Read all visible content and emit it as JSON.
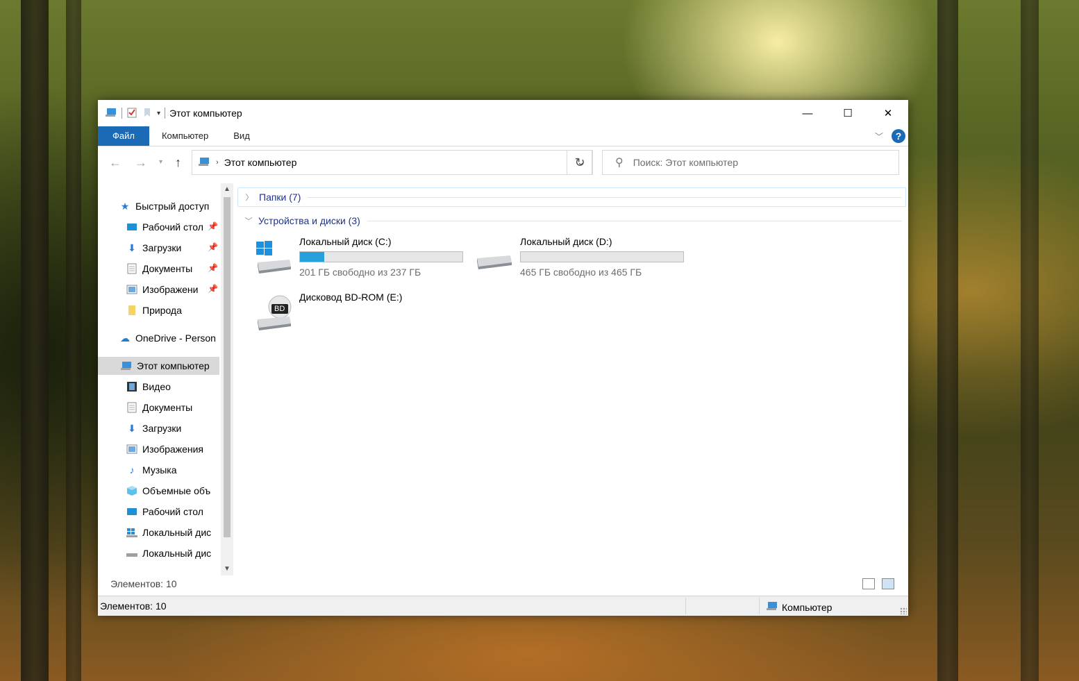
{
  "window": {
    "title": "Этот компьютер"
  },
  "window_controls": {
    "minimize": "—",
    "maximize": "☐",
    "close": "✕"
  },
  "ribbon": {
    "tabs": [
      "Файл",
      "Компьютер",
      "Вид"
    ],
    "help": "?"
  },
  "address_bar": {
    "path": "Этот компьютер"
  },
  "search": {
    "placeholder": "Поиск: Этот компьютер"
  },
  "nav_pane": {
    "quick_access": "Быстрый доступ",
    "quick_items": [
      "Рабочий стол",
      "Загрузки",
      "Документы",
      "Изображени",
      "Природа"
    ],
    "onedrive": "OneDrive - Person",
    "this_pc": "Этот компьютер",
    "pc_items": [
      "Видео",
      "Документы",
      "Загрузки",
      "Изображения",
      "Музыка",
      "Объемные объ",
      "Рабочий стол",
      "Локальный дис",
      "Локальный дис"
    ]
  },
  "content": {
    "folders_group": "Папки (7)",
    "devices_group": "Устройства и диски (3)",
    "drives": [
      {
        "name": "Локальный диск (C:)",
        "free": "201 ГБ свободно из 237 ГБ",
        "used_fraction": 0.15
      },
      {
        "name": "Локальный диск (D:)",
        "free": "465 ГБ свободно из 465 ГБ",
        "used_fraction": 0.0
      },
      {
        "name": "Дисковод BD-ROM (E:)",
        "badge": "BD"
      }
    ]
  },
  "status": {
    "inner_count": "Элементов: 10",
    "count": "Элементов: 10",
    "location": "Компьютер"
  },
  "colors": {
    "accent": "#1a6ab5",
    "progress": "#26a0da",
    "group_text": "#1e3287"
  }
}
